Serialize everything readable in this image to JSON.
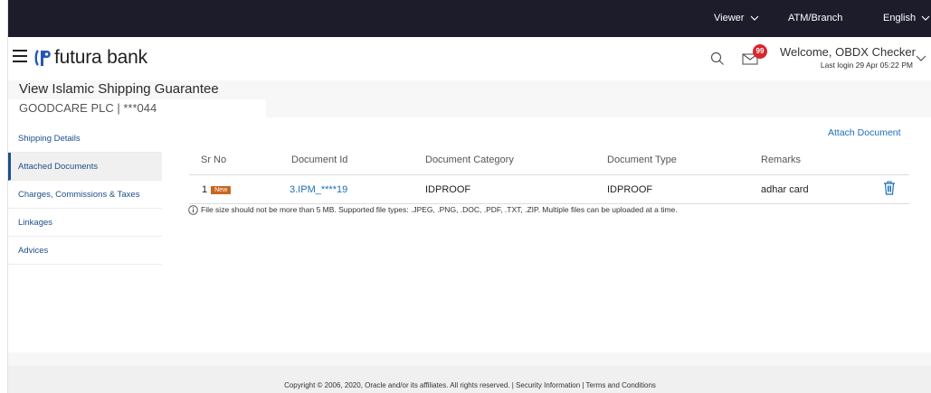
{
  "topbar": {
    "viewer": "Viewer",
    "atm_branch": "ATM/Branch",
    "language": "English"
  },
  "header": {
    "brand": "futura bank",
    "mail_count": "99",
    "welcome": "Welcome, OBDX Checker",
    "last_login": "Last login 29 Apr 05:22 PM"
  },
  "page": {
    "title": "View Islamic Shipping Guarantee",
    "subtitle": "GOODCARE PLC | ***044"
  },
  "sidebar": {
    "items": [
      {
        "label": "Shipping Details"
      },
      {
        "label": "Attached Documents"
      },
      {
        "label": "Charges, Commissions & Taxes"
      },
      {
        "label": "Linkages"
      },
      {
        "label": "Advices"
      }
    ]
  },
  "documents": {
    "attach_label": "Attach Document",
    "columns": [
      "Sr No",
      "Document Id",
      "Document Category",
      "Document Type",
      "Remarks"
    ],
    "rows": [
      {
        "sr_no": "1",
        "tag": "New",
        "document_id": "3.IPM_****19",
        "category": "IDPROOF",
        "type": "IDPROOF",
        "remarks": "adhar card"
      }
    ],
    "note": "File size should not be more than 5 MB. Supported file types: .JPEG, .PNG, .DOC, .PDF, .TXT, .ZIP. Multiple files can be uploaded at a time."
  },
  "footer": {
    "text": "Copyright © 2006, 2020, Oracle and/or its affiliates. All rights reserved. | Security Information | Terms and Conditions"
  },
  "icons": {
    "menu": "hamburger-menu-icon",
    "logo": "futura-logo-icon",
    "search": "search-icon",
    "mail": "mail-icon",
    "chevron": "chevron-down-icon",
    "delete": "trash-icon",
    "info": "info-icon"
  },
  "colors": {
    "topbar_bg": "#1c1c2b",
    "link": "#1b6fb8",
    "nav_text": "#1b4f8a",
    "new_tag": "#c8661f",
    "badge": "#d8262e"
  }
}
